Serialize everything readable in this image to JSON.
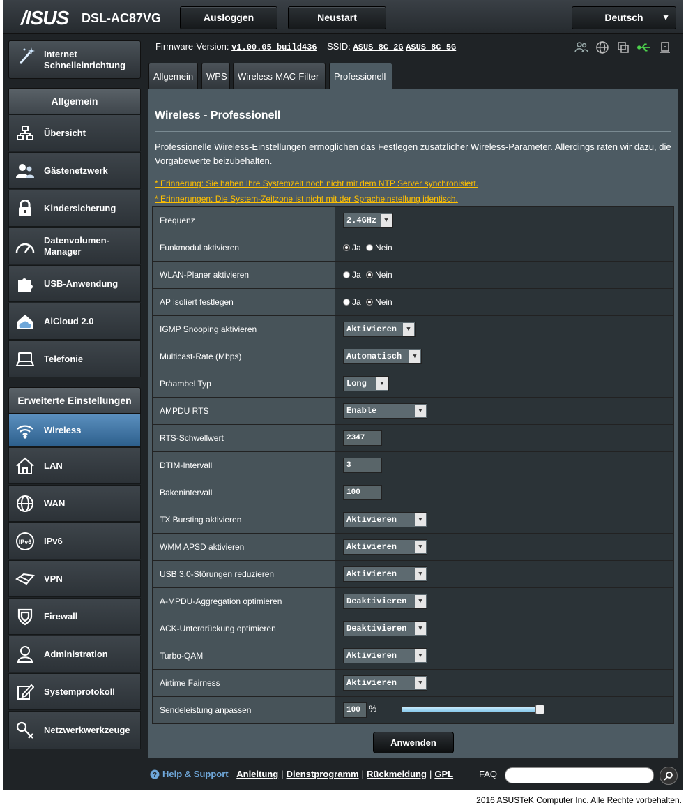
{
  "header": {
    "logo": "/ISUS",
    "model": "DSL-AC87VG",
    "logout_label": "Ausloggen",
    "restart_label": "Neustart",
    "language": "Deutsch"
  },
  "quick_setup": {
    "label_line1": "Internet",
    "label_line2": "Schnelleinrichtung"
  },
  "info": {
    "firmware_label": "Firmware-Version:",
    "firmware_value": "v1.00.05_build436",
    "ssid_label": "SSID:",
    "ssid_2g": "ASUS_8C_2G",
    "ssid_5g": "ASUS_8C_5G"
  },
  "sidebar": {
    "general_heading": "Allgemein",
    "general_items": [
      {
        "label": "Übersicht",
        "icon": "network-map-icon"
      },
      {
        "label": "Gästenetzwerk",
        "icon": "guest-network-icon"
      },
      {
        "label": "Kindersicherung",
        "icon": "lock-icon"
      },
      {
        "label": "Datenvolumen-\nManager",
        "icon": "speedometer-icon"
      },
      {
        "label": "USB-Anwendung",
        "icon": "puzzle-icon"
      },
      {
        "label": "AiCloud 2.0",
        "icon": "cloud-home-icon"
      },
      {
        "label": "Telefonie",
        "icon": "phone-icon"
      }
    ],
    "advanced_heading": "Erweiterte Einstellungen",
    "advanced_items": [
      {
        "label": "Wireless",
        "icon": "wifi-icon"
      },
      {
        "label": "LAN",
        "icon": "house-icon"
      },
      {
        "label": "WAN",
        "icon": "globe-icon"
      },
      {
        "label": "IPv6",
        "icon": "ipv6-icon"
      },
      {
        "label": "VPN",
        "icon": "vpn-icon"
      },
      {
        "label": "Firewall",
        "icon": "shield-icon"
      },
      {
        "label": "Administration",
        "icon": "user-icon"
      },
      {
        "label": "Systemprotokoll",
        "icon": "log-icon"
      },
      {
        "label": "Netzwerkwerkzeuge",
        "icon": "tools-icon"
      }
    ]
  },
  "tabs": [
    "Allgemein",
    "WPS",
    "Wireless-MAC-Filter",
    "Professionell"
  ],
  "page": {
    "title": "Wireless - Professionell",
    "description": "Professionelle Wireless-Einstellungen ermöglichen das Festlegen zusätzlicher Wireless-Parameter. Allerdings raten wir dazu, die Vorgabewerte beizubehalten.",
    "warning1": "* Erinnerung: Sie haben Ihre Systemzeit noch nicht mit dem NTP Server synchronisiert.",
    "warning2": "* Erinnerungen: Die System-Zeitzone ist nicht mit der Spracheinstellung identisch."
  },
  "settings": {
    "frequency": {
      "label": "Frequenz",
      "value": "2.4GHz"
    },
    "radio_enable": {
      "label": "Funkmodul aktivieren",
      "yes": "Ja",
      "no": "Nein",
      "selected": "Ja"
    },
    "wlan_scheduler": {
      "label": "WLAN-Planer aktivieren",
      "yes": "Ja",
      "no": "Nein",
      "selected": "Nein"
    },
    "ap_isolated": {
      "label": "AP isoliert festlegen",
      "yes": "Ja",
      "no": "Nein",
      "selected": "Nein"
    },
    "igmp": {
      "label": "IGMP Snooping aktivieren",
      "value": "Aktivieren"
    },
    "multicast": {
      "label": "Multicast-Rate (Mbps)",
      "value": "Automatisch"
    },
    "preamble": {
      "label": "Präambel Typ",
      "value": "Long"
    },
    "ampdu_rts": {
      "label": "AMPDU RTS",
      "value": "Enable"
    },
    "rts": {
      "label": "RTS-Schwellwert",
      "value": "2347"
    },
    "dtim": {
      "label": "DTIM-Intervall",
      "value": "3"
    },
    "beacon": {
      "label": "Bakenintervall",
      "value": "100"
    },
    "tx_bursting": {
      "label": "TX Bursting aktivieren",
      "value": "Aktivieren"
    },
    "wmm_apsd": {
      "label": "WMM APSD aktivieren",
      "value": "Aktivieren"
    },
    "usb3": {
      "label": "USB 3.0-Störungen reduzieren",
      "value": "Aktivieren"
    },
    "ampdu_agg": {
      "label": "A-MPDU-Aggregation optimieren",
      "value": "Deaktivieren"
    },
    "ack": {
      "label": "ACK-Unterdrückung optimieren",
      "value": "Deaktivieren"
    },
    "turbo_qam": {
      "label": "Turbo-QAM",
      "value": "Aktivieren"
    },
    "airtime": {
      "label": "Airtime Fairness",
      "value": "Aktivieren"
    },
    "tx_power": {
      "label": "Sendeleistung anpassen",
      "value": "100",
      "unit": "%",
      "level": 100
    }
  },
  "apply_label": "Anwenden",
  "footer": {
    "help": "Help & Support",
    "links": [
      "Anleitung",
      "Dienstprogramm",
      "Rückmeldung",
      "GPL"
    ],
    "faq": "FAQ",
    "copyright": "2016 ASUSTeK Computer Inc. Alle Rechte vorbehalten."
  },
  "colors": {
    "accent": "#5b8fbe",
    "warning": "#ffc000",
    "content_bg": "#4d5b63"
  }
}
